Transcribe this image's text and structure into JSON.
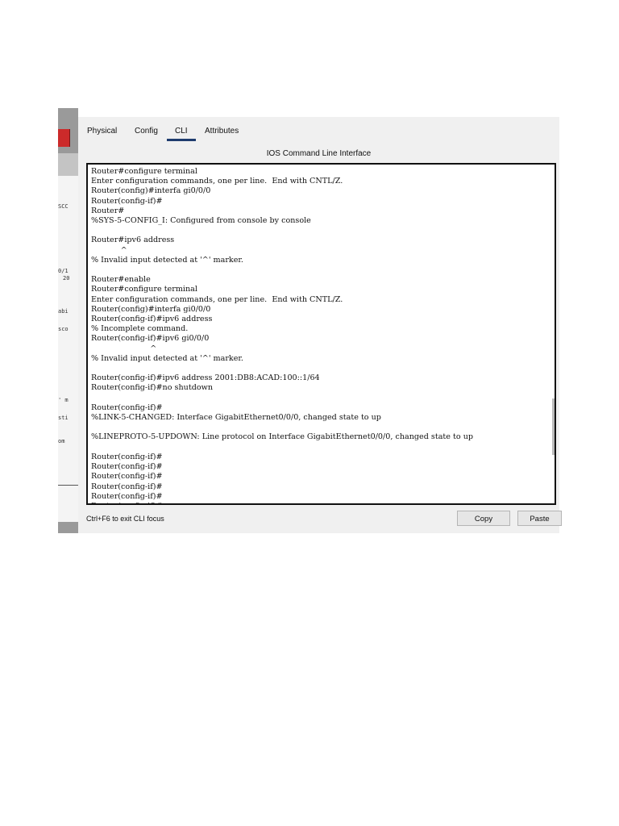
{
  "tabs": [
    "Physical",
    "Config",
    "CLI",
    "Attributes"
  ],
  "active_tab": "CLI",
  "window_title": "IOS Command Line Interface",
  "terminal_lines": [
    "Router#configure terminal",
    "Enter configuration commands, one per line.  End with CNTL/Z.",
    "Router(config)#interfa gi0/0/0",
    "Router(config-if)#",
    "Router#",
    "%SYS-5-CONFIG_I: Configured from console by console",
    "",
    "Router#ipv6 address",
    "            ^",
    "% Invalid input detected at '^' marker.",
    "",
    "Router#enable",
    "Router#configure terminal",
    "Enter configuration commands, one per line.  End with CNTL/Z.",
    "Router(config)#interfa gi0/0/0",
    "Router(config-if)#ipv6 address",
    "% Incomplete command.",
    "Router(config-if)#ipv6 gi0/0/0",
    "                        ^",
    "% Invalid input detected at '^' marker.",
    "",
    "Router(config-if)#ipv6 address 2001:DB8:ACAD:100::1/64",
    "Router(config-if)#no shutdown",
    "",
    "Router(config-if)#",
    "%LINK-5-CHANGED: Interface GigabitEthernet0/0/0, changed state to up",
    "",
    "%LINEPROTO-5-UPDOWN: Line protocol on Interface GigabitEthernet0/0/0, changed state to up",
    "",
    "Router(config-if)#",
    "Router(config-if)#",
    "Router(config-if)#",
    "Router(config-if)#",
    "Router(config-if)#",
    "Router(config-if)#"
  ],
  "status_text": "Ctrl+F6 to exit CLI focus",
  "copy_label": "Copy",
  "paste_label": "Paste",
  "background_fragments": [
    "SCC",
    "0/1",
    "20",
    "abi",
    "sco",
    "' m",
    "sti",
    "om"
  ],
  "colors": {
    "tab_underline": "#1e3b6e",
    "panel_bg": "#f0f0f0",
    "terminal_bg": "#ffffff"
  }
}
